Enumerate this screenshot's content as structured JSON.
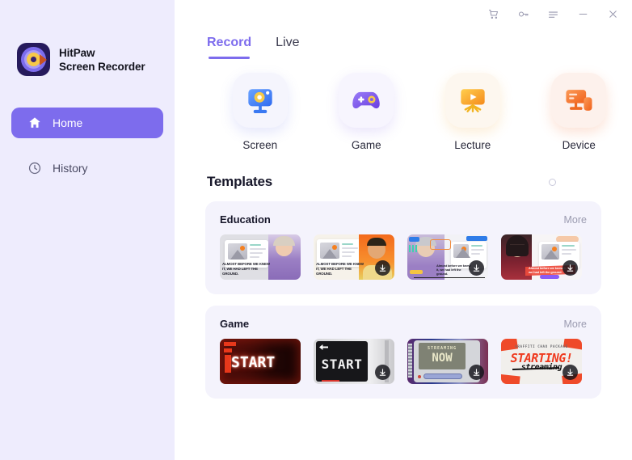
{
  "app": {
    "brand_line1": "HitPaw",
    "brand_line2": "Screen Recorder",
    "logo_icon": "hitpaw-logo-icon"
  },
  "titlebar": {
    "buttons": [
      {
        "name": "cart-icon",
        "label": "Store"
      },
      {
        "name": "key-icon",
        "label": "Register"
      },
      {
        "name": "menu-icon",
        "label": "Menu"
      },
      {
        "name": "minimize-icon",
        "label": "Minimize"
      },
      {
        "name": "close-icon",
        "label": "Close"
      }
    ]
  },
  "sidebar": {
    "items": [
      {
        "label": "Home",
        "icon": "home-icon",
        "active": true
      },
      {
        "label": "History",
        "icon": "clock-icon",
        "active": false
      }
    ]
  },
  "tabs": [
    {
      "label": "Record",
      "active": true
    },
    {
      "label": "Live",
      "active": false
    }
  ],
  "modes": [
    {
      "label": "Screen",
      "icon": "monitor-record-icon",
      "accent": "#3d7bf7"
    },
    {
      "label": "Game",
      "icon": "gamepad-icon",
      "accent": "#7d5cf0"
    },
    {
      "label": "Lecture",
      "icon": "presentation-play-icon",
      "accent": "#f7a420"
    },
    {
      "label": "Device",
      "icon": "device-phone-icon",
      "accent": "#f4731f"
    }
  ],
  "templates": {
    "title": "Templates",
    "refresh_icon": "refresh-dot-icon",
    "more_label": "More",
    "groups": [
      {
        "title": "Education",
        "more": "More",
        "items": [
          {
            "caption": "ALMOST BEFORE WE KNEW IT, WE HAD LEFT THE GROUND.",
            "has_download": false,
            "style": "edu-1"
          },
          {
            "caption": "ALMOST BEFORE WE KNEW IT, WE HAD LEFT THE GROUND.",
            "has_download": true,
            "style": "edu-2"
          },
          {
            "caption": "Almost before we knew it, we had left the ground.",
            "has_download": true,
            "style": "edu-3"
          },
          {
            "caption": "Almost before we knew it, we had left the ground.",
            "has_download": true,
            "style": "edu-4"
          }
        ]
      },
      {
        "title": "Game",
        "more": "More",
        "items": [
          {
            "caption": "START",
            "has_download": false,
            "style": "game-neon"
          },
          {
            "caption": "START",
            "has_download": true,
            "style": "game-retro"
          },
          {
            "caption": "STREAMING NOW",
            "has_download": true,
            "style": "game-crt"
          },
          {
            "caption": "STARTING! streaming",
            "has_download": true,
            "style": "game-graffiti",
            "sub": "GRAFFITI CHAO PACKAGE"
          }
        ]
      }
    ]
  },
  "colors": {
    "accent": "#7d6ced",
    "sidebar_bg": "#eeecfd",
    "group_bg": "#f4f3fc",
    "text_primary": "#17172a",
    "text_muted": "#9b9bb0"
  }
}
